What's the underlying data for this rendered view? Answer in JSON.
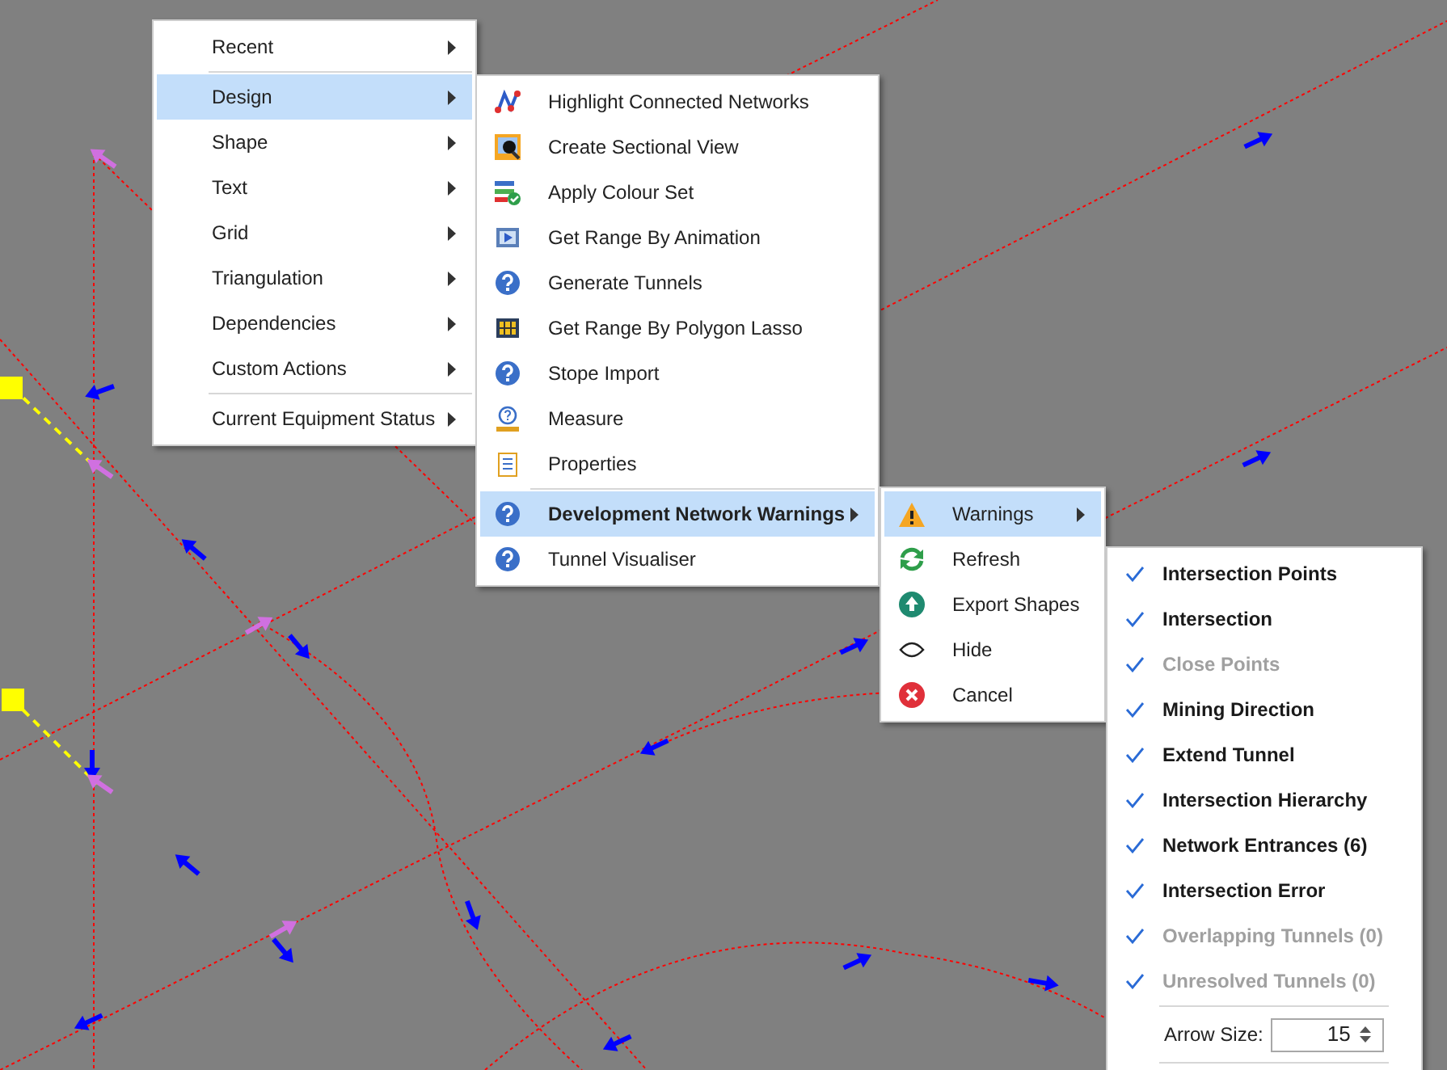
{
  "context_menu": {
    "items": [
      {
        "kind": "item",
        "label": "Recent",
        "selected": false,
        "submenu": true
      },
      {
        "kind": "separator"
      },
      {
        "kind": "item",
        "label": "Design",
        "selected": true,
        "submenu": true
      },
      {
        "kind": "item",
        "label": "Shape",
        "selected": false,
        "submenu": true
      },
      {
        "kind": "item",
        "label": "Text",
        "selected": false,
        "submenu": true
      },
      {
        "kind": "item",
        "label": "Grid",
        "selected": false,
        "submenu": true
      },
      {
        "kind": "item",
        "label": "Triangulation",
        "selected": false,
        "submenu": true
      },
      {
        "kind": "item",
        "label": "Dependencies",
        "selected": false,
        "submenu": true
      },
      {
        "kind": "item",
        "label": "Custom Actions",
        "selected": false,
        "submenu": true
      },
      {
        "kind": "separator"
      },
      {
        "kind": "item",
        "label": "Current Equipment Status",
        "selected": false,
        "submenu": true
      }
    ]
  },
  "design_submenu": {
    "items": [
      {
        "kind": "item",
        "label": "Highlight Connected Networks",
        "selected": false,
        "submenu": false,
        "bold": false
      },
      {
        "kind": "item",
        "label": "Create Sectional View",
        "selected": false,
        "submenu": false,
        "bold": false
      },
      {
        "kind": "item",
        "label": "Apply Colour Set",
        "selected": false,
        "submenu": false,
        "bold": false
      },
      {
        "kind": "item",
        "label": "Get Range By Animation",
        "selected": false,
        "submenu": false,
        "bold": false
      },
      {
        "kind": "item",
        "label": "Generate Tunnels",
        "selected": false,
        "submenu": false,
        "bold": false
      },
      {
        "kind": "item",
        "label": "Get Range By Polygon Lasso",
        "selected": false,
        "submenu": false,
        "bold": false
      },
      {
        "kind": "item",
        "label": "Stope Import",
        "selected": false,
        "submenu": false,
        "bold": false
      },
      {
        "kind": "item",
        "label": "Measure",
        "selected": false,
        "submenu": false,
        "bold": false
      },
      {
        "kind": "item",
        "label": "Properties",
        "selected": false,
        "submenu": false,
        "bold": false
      },
      {
        "kind": "separator"
      },
      {
        "kind": "item",
        "label": "Development Network Warnings",
        "selected": true,
        "submenu": true,
        "bold": true
      },
      {
        "kind": "item",
        "label": "Tunnel Visualiser",
        "selected": false,
        "submenu": false,
        "bold": false
      }
    ]
  },
  "warnings_submenu": {
    "items": [
      {
        "kind": "item",
        "label": "Warnings",
        "selected": true,
        "submenu": true
      },
      {
        "kind": "item",
        "label": "Refresh",
        "selected": false,
        "submenu": false
      },
      {
        "kind": "item",
        "label": "Export Shapes",
        "selected": false,
        "submenu": false
      },
      {
        "kind": "item",
        "label": "Hide",
        "selected": false,
        "submenu": false
      },
      {
        "kind": "item",
        "label": "Cancel",
        "selected": false,
        "submenu": false
      }
    ]
  },
  "warning_types_menu": {
    "items": [
      {
        "label": "Intersection Points",
        "checked": true,
        "disabled": false
      },
      {
        "label": "Intersection",
        "checked": true,
        "disabled": false
      },
      {
        "label": "Close Points",
        "checked": true,
        "disabled": true
      },
      {
        "label": "Mining Direction",
        "checked": true,
        "disabled": false
      },
      {
        "label": "Extend Tunnel",
        "checked": true,
        "disabled": false
      },
      {
        "label": "Intersection Hierarchy",
        "checked": true,
        "disabled": false
      },
      {
        "label": "Network Entrances (6)",
        "checked": true,
        "disabled": false
      },
      {
        "label": "Intersection Error",
        "checked": true,
        "disabled": false
      },
      {
        "label": "Overlapping Tunnels (0)",
        "checked": true,
        "disabled": true
      },
      {
        "label": "Unresolved Tunnels (0)",
        "checked": true,
        "disabled": true
      }
    ],
    "arrow_size": {
      "label": "Arrow Size:",
      "value": "15"
    }
  }
}
